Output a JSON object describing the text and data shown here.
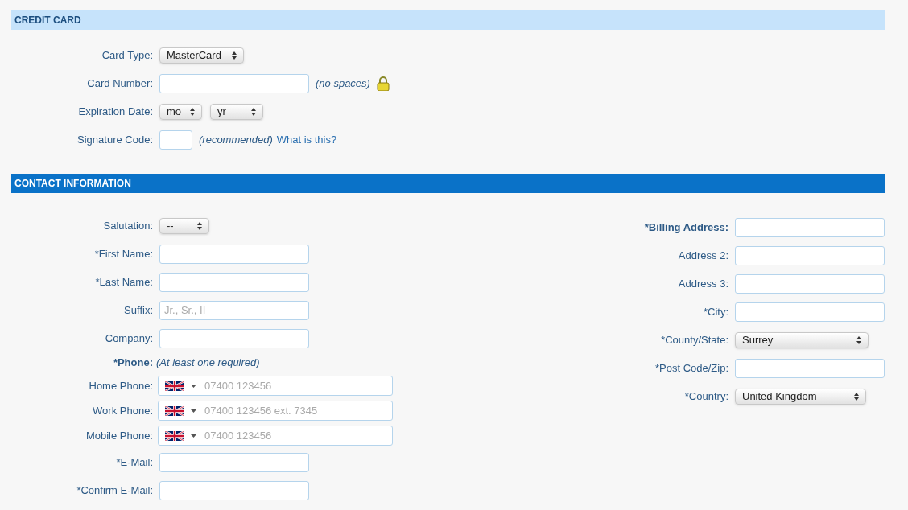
{
  "credit_card": {
    "title": "CREDIT CARD",
    "fields": [
      {
        "kind": "select",
        "label": "Card Type:",
        "value": "MasterCard"
      },
      {
        "kind": "text",
        "label": "Card Number:",
        "hint": "(no spaces)",
        "secure": true
      },
      {
        "kind": "select-pair",
        "label": "Expiration Date:",
        "values": [
          "mo",
          "yr"
        ]
      },
      {
        "kind": "text",
        "label": "Signature Code:",
        "hint": "(recommended)",
        "link": "What is this?"
      }
    ]
  },
  "contact_information": {
    "title": "CONTACT INFORMATION",
    "left_fields": [
      {
        "kind": "select",
        "label": "Salutation:",
        "value": "--"
      },
      {
        "kind": "text",
        "label": "*First Name:"
      },
      {
        "kind": "text",
        "label": "*Last Name:"
      },
      {
        "kind": "text",
        "label": "Suffix:",
        "placeholder": "Jr., Sr., II"
      },
      {
        "kind": "text",
        "label": "Company:"
      },
      {
        "kind": "note",
        "label": "*Phone:",
        "bold": true,
        "hint": "(At least one required)"
      },
      {
        "kind": "phone",
        "label": "Home Phone:",
        "placeholder": "07400 123456"
      },
      {
        "kind": "phone",
        "label": "Work Phone:",
        "placeholder": "07400 123456 ext. 7345"
      },
      {
        "kind": "phone",
        "label": "Mobile Phone:",
        "placeholder": "07400 123456"
      },
      {
        "kind": "text",
        "label": "*E-Mail:"
      },
      {
        "kind": "text",
        "label": "*Confirm E-Mail:"
      }
    ],
    "right_fields": [
      {
        "kind": "text",
        "label": "*Billing Address:",
        "bold": true
      },
      {
        "kind": "text",
        "label": "Address 2:"
      },
      {
        "kind": "text",
        "label": "Address 3:"
      },
      {
        "kind": "text",
        "label": "*City:"
      },
      {
        "kind": "select",
        "label": "*County/State:",
        "value": "Surrey"
      },
      {
        "kind": "text",
        "label": "*Post Code/Zip:"
      },
      {
        "kind": "select",
        "label": "*Country:",
        "value": "United Kingdom"
      }
    ]
  }
}
